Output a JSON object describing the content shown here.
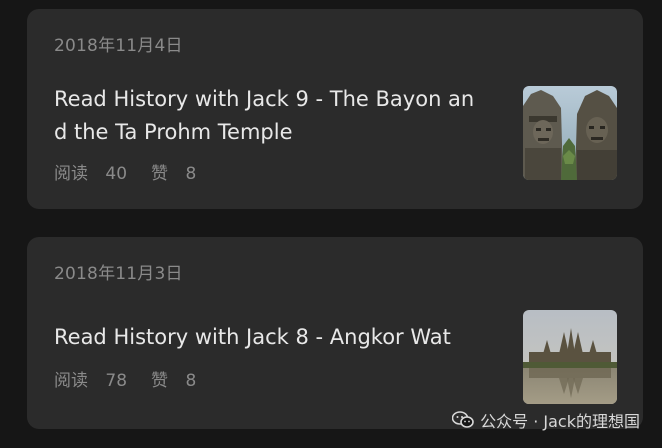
{
  "articles": [
    {
      "date": "2018年11月4日",
      "title_line1": "Read History with Jack 9 - The Bayon an",
      "title_line2": "d the Ta Prohm Temple",
      "reads_label": "阅读",
      "reads": "40",
      "likes_label": "赞",
      "likes": "8",
      "thumbnail": "bayon-temple-stone-faces-image"
    },
    {
      "date": "2018年11月3日",
      "title_line1": "Read History with Jack 8 - Angkor Wat",
      "reads_label": "阅读",
      "reads": "78",
      "likes_label": "赞",
      "likes": "8",
      "thumbnail": "angkor-wat-reflection-image"
    }
  ],
  "watermark": {
    "icon": "wechat-icon",
    "text": "公众号 · Jack的理想国"
  }
}
